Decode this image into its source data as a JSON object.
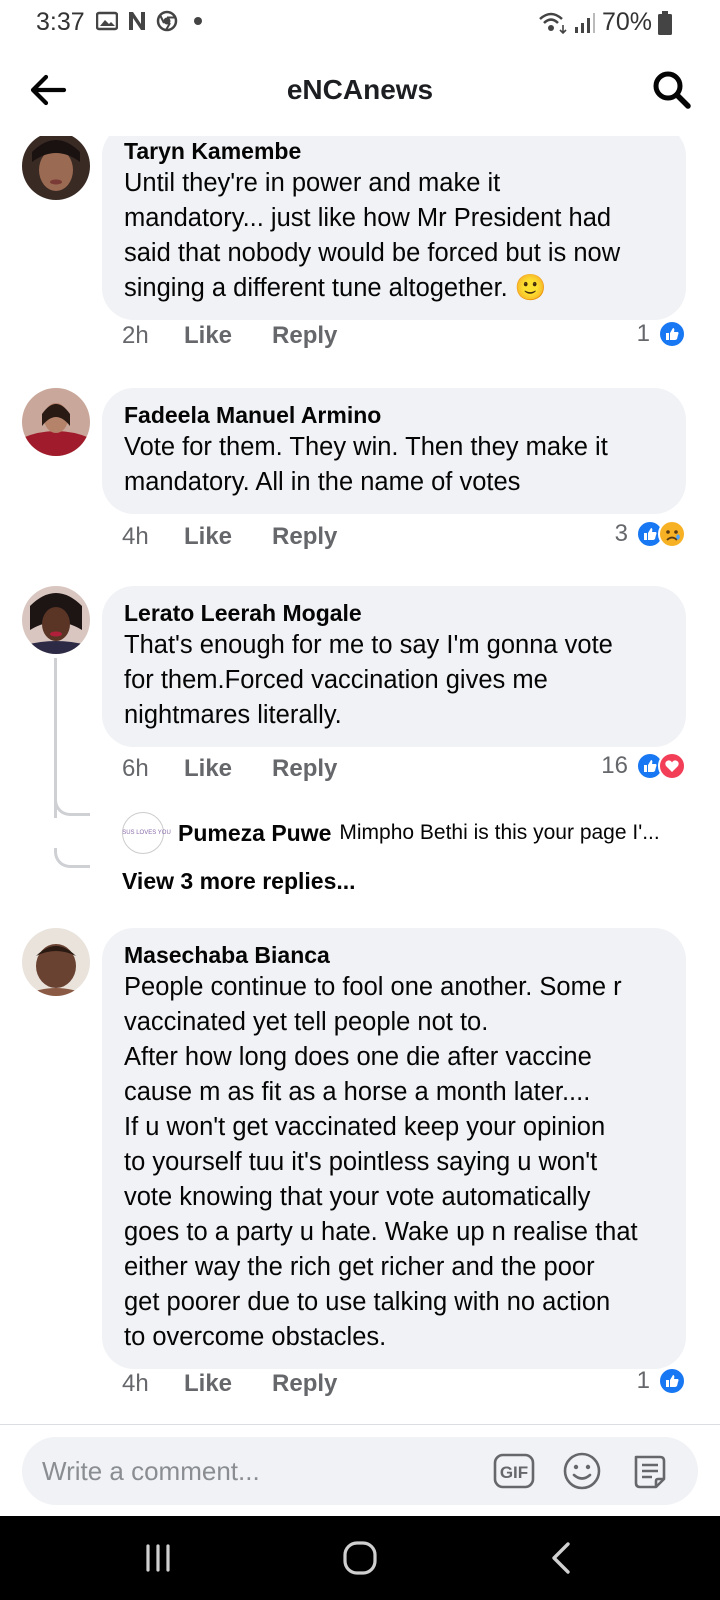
{
  "status_bar": {
    "time": "3:37",
    "battery": "70%"
  },
  "app_bar": {
    "title": "eNCAnews"
  },
  "comments": [
    {
      "author": "Taryn Kamembe",
      "text": "Until they're in power and make it\nmandatory... just like how Mr President had\nsaid that nobody would be forced but is now\nsinging a different tune altogether. 🙂",
      "time": "2h",
      "like_label": "Like",
      "reply_label": "Reply",
      "reaction_count": "1",
      "reactions": [
        "like"
      ]
    },
    {
      "author": "Fadeela Manuel Armino",
      "text": "Vote for them. They win. Then they make it\nmandatory. All in the name of votes",
      "time": "4h",
      "like_label": "Like",
      "reply_label": "Reply",
      "reaction_count": "3",
      "reactions": [
        "like",
        "sad"
      ]
    },
    {
      "author": "Lerato Leerah Mogale",
      "text": "That's enough for me to say I'm gonna vote\nfor them.Forced vaccination gives me\nnightmares literally.",
      "time": "6h",
      "like_label": "Like",
      "reply_label": "Reply",
      "reaction_count": "16",
      "reactions": [
        "like",
        "love"
      ],
      "reply_preview": {
        "author": "Pumeza Puwe",
        "text": "Mimpho Bethi is this your page I'...",
        "avatar_text": "JESUS LOVES YOU"
      },
      "more_replies": "View 3 more replies..."
    },
    {
      "author": "Masechaba Bianca",
      "text": "People continue to fool one another. Some r\nvaccinated yet tell people not to.\nAfter how long does one die after vaccine\ncause m as fit as a horse a month later....\nIf u won't get vaccinated keep your opinion\nto yourself tuu it's pointless saying u won't\nvote knowing that your vote automatically\ngoes to a party u hate. Wake up n realise that\neither way the rich get richer and the poor\nget poorer due to use talking with no action\nto overcome obstacles.",
      "time": "4h",
      "like_label": "Like",
      "reply_label": "Reply",
      "reaction_count": "1",
      "reactions": [
        "like"
      ]
    }
  ],
  "composer": {
    "placeholder": "Write a comment...",
    "gif_label": "GIF"
  },
  "colors": {
    "like_blue": "#1877f2",
    "love_red": "#f33e58",
    "sad_yellow": "#f7b125",
    "bubble_bg": "#f0f2f5",
    "meta_gray": "#65676b"
  },
  "icons": {
    "back": "arrow-left-icon",
    "search": "search-icon",
    "gif": "gif-icon",
    "emoji": "emoji-icon",
    "sticker": "sticker-icon"
  }
}
